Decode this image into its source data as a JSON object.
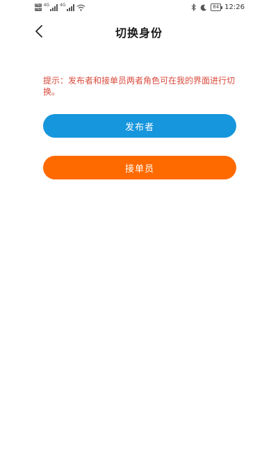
{
  "status_bar": {
    "sim1_tags": [
      "HD",
      "HD"
    ],
    "net1": "4G",
    "net2": "4G",
    "battery": "84",
    "time": "12:26",
    "icons": [
      "signal-icon",
      "wifi-icon",
      "bluetooth-icon",
      "moon-icon",
      "battery-icon"
    ]
  },
  "header": {
    "title": "切换身份",
    "back_icon": "chevron-left-icon"
  },
  "main": {
    "tip": "提示：发布者和接单员两者角色可在我的界面进行切换。",
    "publisher_label": "发布者",
    "receiver_label": "接单员"
  },
  "colors": {
    "tip": "#d84a3c",
    "publisher_button": "#1696dc",
    "receiver_button": "#ff6a00"
  }
}
